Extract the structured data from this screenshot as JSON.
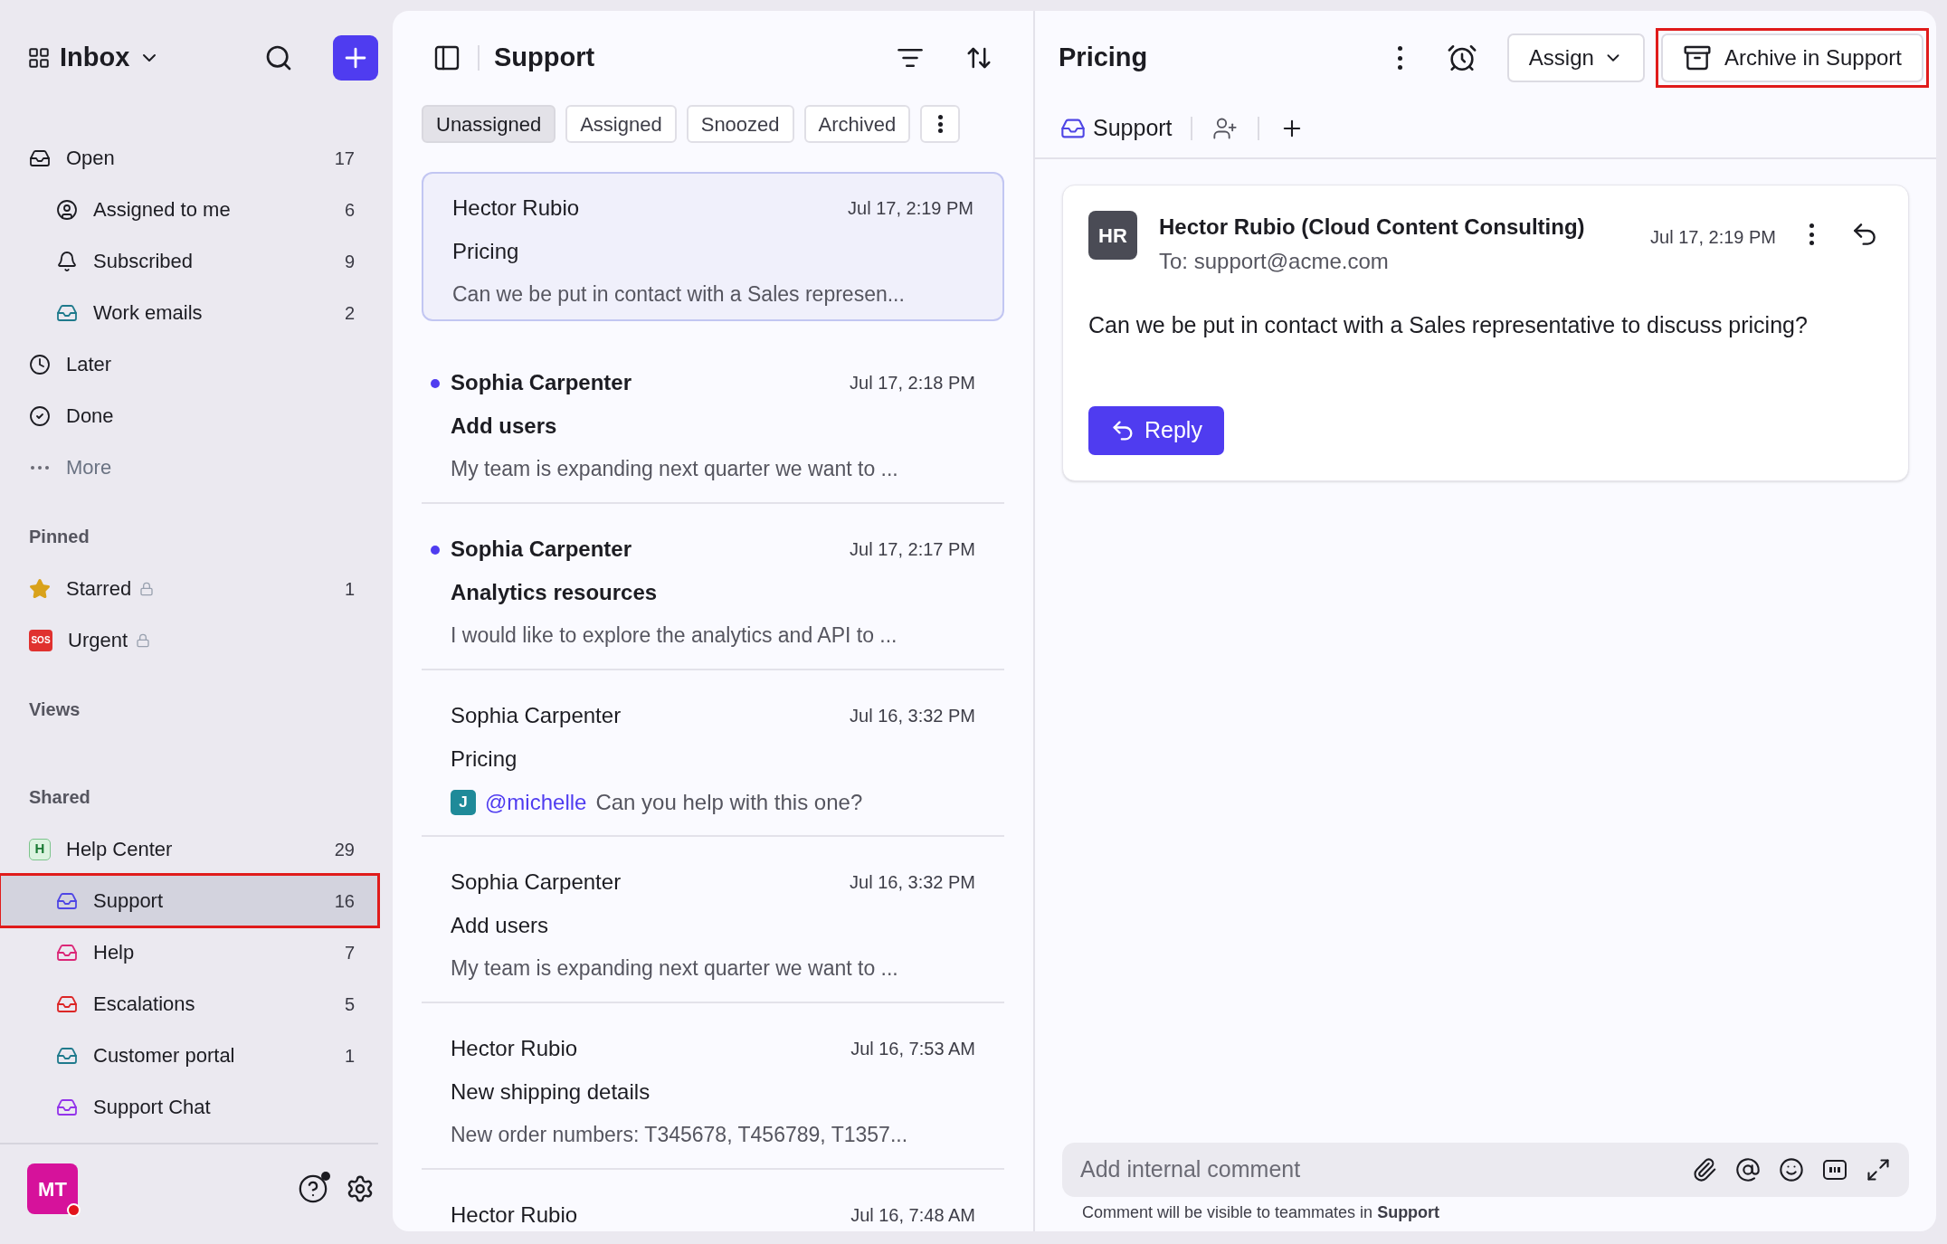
{
  "sidebar": {
    "title": "Inbox",
    "user_avatar": {
      "initials": "MT",
      "online": true
    },
    "nav": [
      {
        "label": "Open",
        "kind": "inbox",
        "count": "17",
        "children": [
          {
            "label": "Assigned to me",
            "kind": "user",
            "count": "6"
          },
          {
            "label": "Subscribed",
            "kind": "bell",
            "count": "9"
          },
          {
            "label": "Work emails",
            "kind": "inbox",
            "color": "#1f7a8c",
            "count": "2"
          }
        ]
      },
      {
        "label": "Later",
        "kind": "clock"
      },
      {
        "label": "Done",
        "kind": "check"
      },
      {
        "label": "More",
        "kind": "more",
        "muted": true
      }
    ],
    "sections": [
      {
        "title": "Pinned",
        "items": [
          {
            "label": "Starred",
            "kind": "star",
            "locked": true,
            "count": "1"
          },
          {
            "label": "Urgent",
            "kind": "sos",
            "icon_text": "SOS",
            "locked": true
          }
        ]
      },
      {
        "title": "Views"
      },
      {
        "title": "Shared",
        "items": [
          {
            "label": "Help Center",
            "kind": "badge",
            "icon_text": "H",
            "count": "29",
            "children": [
              {
                "label": "Support",
                "kind": "inbox",
                "color": "#4f46e5",
                "count": "16",
                "selected": true,
                "highlighted": true
              },
              {
                "label": "Help",
                "kind": "inbox",
                "color": "#db2777",
                "count": "7",
                "selected": false
              },
              {
                "label": "Escalations",
                "kind": "inbox",
                "color": "#dc2626",
                "count": "5",
                "selected": false
              },
              {
                "label": "Customer portal",
                "kind": "inbox",
                "color": "#1f7a8c",
                "count": "1",
                "selected": false
              },
              {
                "label": "Support Chat",
                "kind": "inbox",
                "color": "#9333ea",
                "selected": false
              }
            ]
          }
        ]
      }
    ]
  },
  "list": {
    "title": "Support",
    "tabs": [
      {
        "label": "Unassigned",
        "selected": true
      },
      {
        "label": "Assigned",
        "selected": false
      },
      {
        "label": "Snoozed",
        "selected": false
      },
      {
        "label": "Archived",
        "selected": false
      }
    ],
    "messages": [
      {
        "sender": "Hector Rubio",
        "time": "Jul 17, 2:19 PM",
        "subject": "Pricing",
        "preview": "Can we be put in contact with a Sales represen...",
        "unread": false,
        "selected": true
      },
      {
        "sender": "Sophia Carpenter",
        "time": "Jul 17, 2:18 PM",
        "subject": "Add users",
        "preview": "My team is expanding next quarter we want to ...",
        "unread": true,
        "selected": false
      },
      {
        "sender": "Sophia Carpenter",
        "time": "Jul 17, 2:17 PM",
        "subject": "Analytics resources",
        "preview": "I would like to explore the analytics and API to ...",
        "unread": true,
        "selected": false
      },
      {
        "sender": "Sophia Carpenter",
        "time": "Jul 16, 3:32 PM",
        "subject": "Pricing",
        "comment": {
          "avatar": "J",
          "mention": "@michelle",
          "text": "Can you help with this one?"
        },
        "unread": false,
        "selected": false
      },
      {
        "sender": "Sophia Carpenter",
        "time": "Jul 16, 3:32 PM",
        "subject": "Add users",
        "preview": "My team is expanding next quarter we want to ...",
        "unread": false,
        "selected": false
      },
      {
        "sender": "Hector Rubio",
        "time": "Jul 16, 7:53 AM",
        "subject": "New shipping details",
        "preview": "New order numbers: T345678, T456789, T1357...",
        "unread": false,
        "selected": false
      },
      {
        "sender": "Hector Rubio",
        "time": "Jul 16, 7:48 AM",
        "unread": false,
        "selected": false
      }
    ]
  },
  "detail": {
    "title": "Pricing",
    "assign": "Assign",
    "archive": {
      "label": "Archive in Support",
      "highlighted": true
    },
    "inbox_tag": "Support",
    "email": {
      "avatar": "HR",
      "from": "Hector Rubio (Cloud Content Consulting)",
      "to": "To: support@acme.com",
      "time": "Jul 17, 2:19 PM",
      "body": "Can we be put in contact with a Sales representative to discuss pricing?",
      "reply": "Reply"
    },
    "comment": {
      "placeholder": "Add internal comment",
      "note": "Comment will be visible to teammates in **Support**"
    }
  }
}
